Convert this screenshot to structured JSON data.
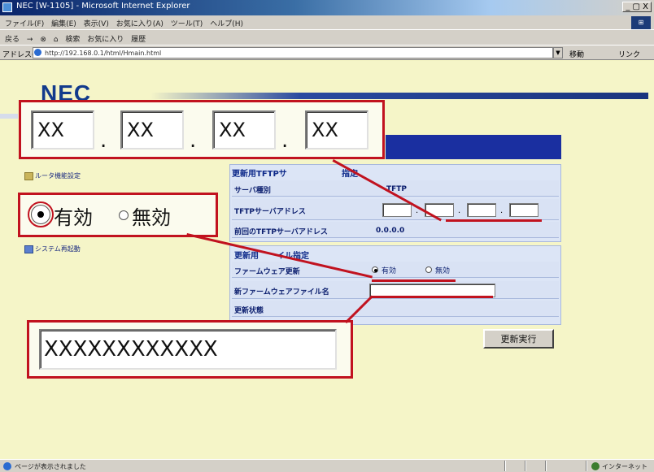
{
  "window": {
    "title": "NEC [W-1105] - Microsoft Internet Explorer",
    "controls": "_ ▢ X"
  },
  "menubar": {
    "items": [
      "ファイル(F)",
      "編集(E)",
      "表示(V)",
      "お気に入り(A)",
      "ツール(T)",
      "ヘルプ(H)"
    ]
  },
  "toolbar": {
    "items": [
      "戻る",
      "→",
      "⊗",
      "⌂",
      "検索",
      "お気に入り",
      "履歴"
    ]
  },
  "addressbar": {
    "label": "アドレス(D)",
    "url": "http://192.168.0.1/html/Hmain.html",
    "go": "移動",
    "links": "リンク"
  },
  "logo": "NEC",
  "callouts": {
    "ip_values": [
      "XX",
      "XX",
      "XX",
      "XX"
    ],
    "ip_separator": ".",
    "radio_on_label": "有効",
    "radio_off_label": "無効",
    "file_value": "XXXXXXXXXXXX"
  },
  "nav": {
    "router_settings": "ルータ機能設定",
    "system_restart": "システム再起動"
  },
  "section1": {
    "title": "更新用TFTPサ",
    "title_tail": "指定",
    "rows": [
      {
        "label": "サーバ種別",
        "value": "TFTP"
      },
      {
        "label": "TFTPサーバアドレス",
        "value": ""
      },
      {
        "label": "前回のTFTPサーバアドレス",
        "value": "0.0.0.0"
      }
    ]
  },
  "section2": {
    "title": "更新用",
    "title_tail": "イル指定",
    "rows": [
      {
        "label": "ファームウェア更新",
        "on": "有効",
        "off": "無効"
      },
      {
        "label": "新ファームウェアファイル名"
      },
      {
        "label": "更新状態"
      }
    ]
  },
  "update_button": "更新実行",
  "statusbar": {
    "left": "ページが表示されました",
    "zone": "インターネット"
  },
  "colors": {
    "callout_red": "#c1121f",
    "nec_blue": "#123a8c",
    "page_bg": "#f5f5c8",
    "panel_bg": "#d9e2f4"
  }
}
